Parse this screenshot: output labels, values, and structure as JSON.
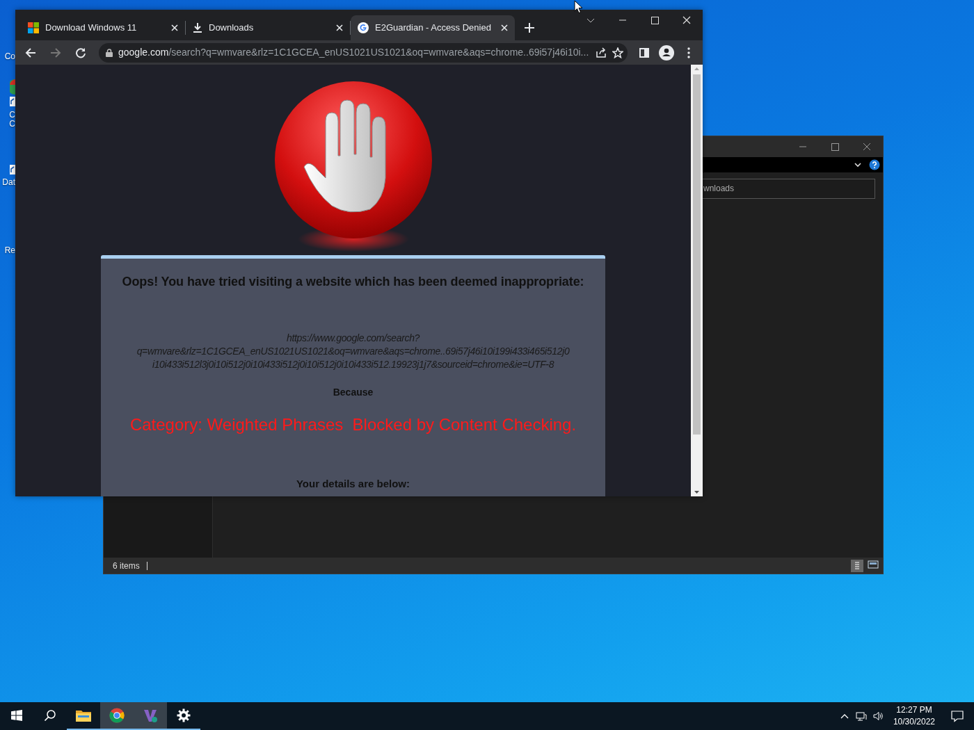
{
  "desktop": {
    "icons": [
      {
        "label": "Co"
      },
      {
        "label": "C"
      },
      {
        "label": "C"
      },
      {
        "label": "Dat"
      },
      {
        "label": "Re"
      }
    ]
  },
  "explorer": {
    "address": "wnloads",
    "status": "6 items"
  },
  "browser": {
    "tabs": [
      {
        "title": "Download Windows 11",
        "kind": "windows",
        "selected": false
      },
      {
        "title": "Downloads",
        "kind": "download",
        "selected": false
      },
      {
        "title": "E2Guardian - Access Denied",
        "kind": "google",
        "selected": true
      }
    ],
    "address": {
      "host": "google.com",
      "path": "/search?q=wmvare&rlz=1C1GCEA_enUS1021US1021&oq=wmvare&aqs=chrome..69i57j46i10i..."
    },
    "page": {
      "heading": "Oops! You have tried visiting a website which has been deemed inappropriate:",
      "url_lines": [
        "https://www.google.com/search?",
        "q=wmvare&rlz=1C1GCEA_enUS1021US1021&oq=wmvare&aqs=chrome..69i57j46i10i199i433i465i512j0",
        "i10i433i512l3j0i10i512j0i10i433i512j0i10i512j0i10i433i512.19923j1j7&sourceid=chrome&ie=UTF-8"
      ],
      "because": "Because",
      "reason": "Category: Weighted Phrases  Blocked by Content Checking.",
      "details_heading": "Your details are below:"
    }
  },
  "taskbar": {
    "items": [
      {
        "kind": "start",
        "running": false,
        "selected": false
      },
      {
        "kind": "search",
        "running": false,
        "selected": false
      },
      {
        "kind": "explorer",
        "running": true,
        "selected": false
      },
      {
        "kind": "chrome",
        "running": true,
        "selected": true
      },
      {
        "kind": "studio",
        "running": true,
        "selected": true
      },
      {
        "kind": "settings",
        "running": true,
        "selected": false
      }
    ],
    "time": "12:27 PM",
    "date": "10/30/2022"
  }
}
